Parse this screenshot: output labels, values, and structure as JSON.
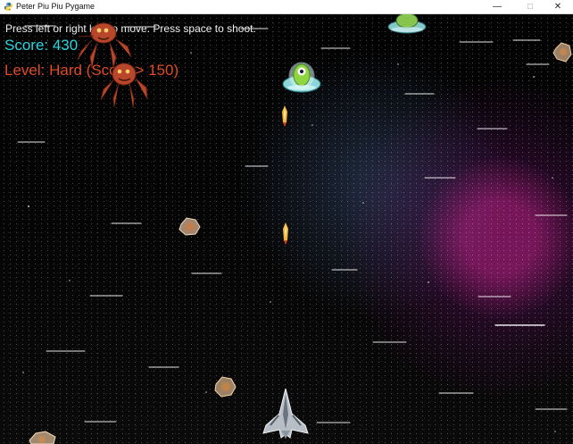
{
  "window": {
    "title": "Peter Piu Piu Pygame",
    "controls": {
      "minimize": "—",
      "maximize": "□",
      "close": "✕"
    }
  },
  "hud": {
    "instructions": "Press left or right key to move. Press space to shoot.",
    "score": "Score: 430",
    "level": "Level: Hard (Score > 150)"
  },
  "colors": {
    "title_bar": "#ffffff",
    "score": "#27d6df",
    "level": "#e04b28",
    "space_background": "#000000",
    "nebula": "#c8238f"
  },
  "sprites": [
    "player-spaceship",
    "alien-ufo",
    "orange-spider-alien",
    "asteroid",
    "missile"
  ]
}
